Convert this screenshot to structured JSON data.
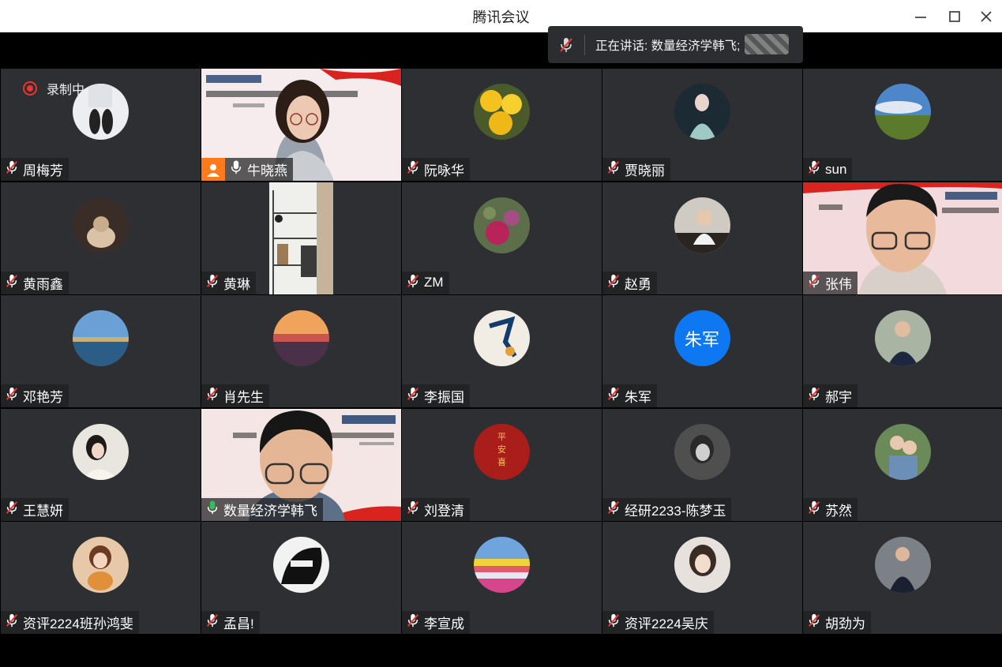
{
  "window": {
    "title": "腾讯会议"
  },
  "speaking": {
    "label": "正在讲话: 数量经济学韩飞;"
  },
  "recording": {
    "label": "录制中"
  },
  "colors": {
    "muted_red": "#ffffff",
    "speaking_green": "#2ec35a",
    "host_orange": "#ff7a1a",
    "tile_bg": "#2e2f33",
    "text_avatar_blue": "#0d78f2"
  },
  "participants": [
    {
      "name": "周梅芳",
      "mic": "muted",
      "avatar": "photo-feet"
    },
    {
      "name": "牛晓燕",
      "mic": "on",
      "avatar": "video",
      "host": true
    },
    {
      "name": "阮咏华",
      "mic": "muted",
      "avatar": "photo-flowers-yellow"
    },
    {
      "name": "贾晓丽",
      "mic": "muted",
      "avatar": "photo-woman-costume"
    },
    {
      "name": "sun",
      "mic": "muted",
      "avatar": "photo-landscape-sky"
    },
    {
      "name": "黄雨鑫",
      "mic": "muted",
      "avatar": "photo-cat"
    },
    {
      "name": "黄琳",
      "mic": "muted",
      "avatar": "photo-bookshelf"
    },
    {
      "name": "ZM",
      "mic": "muted",
      "avatar": "photo-flowers-pink"
    },
    {
      "name": "赵勇",
      "mic": "muted",
      "avatar": "photo-man-piano"
    },
    {
      "name": "张伟",
      "mic": "muted",
      "avatar": "video"
    },
    {
      "name": "邓艳芳",
      "mic": "muted",
      "avatar": "photo-lake"
    },
    {
      "name": "肖先生",
      "mic": "muted",
      "avatar": "photo-sunset"
    },
    {
      "name": "李振国",
      "mic": "muted",
      "avatar": "photo-gymnast"
    },
    {
      "name": "朱军",
      "mic": "muted",
      "avatar": "text",
      "avatar_text": "朱军"
    },
    {
      "name": "郝宇",
      "mic": "muted",
      "avatar": "photo-man-suit"
    },
    {
      "name": "王慧妍",
      "mic": "muted",
      "avatar": "photo-woman-white"
    },
    {
      "name": "数量经济学韩飞",
      "mic": "speaking",
      "avatar": "video"
    },
    {
      "name": "刘登清",
      "mic": "muted",
      "avatar": "photo-red-calligraphy"
    },
    {
      "name": "经研2233-陈梦玉",
      "mic": "muted",
      "avatar": "photo-woman-bw"
    },
    {
      "name": "苏然",
      "mic": "muted",
      "avatar": "photo-family"
    },
    {
      "name": "资评2224班孙鸿斐",
      "mic": "muted",
      "avatar": "photo-girl-cat"
    },
    {
      "name": "孟昌!",
      "mic": "muted",
      "avatar": "photo-man-sunglasses"
    },
    {
      "name": "李宣成",
      "mic": "muted",
      "avatar": "photo-tulip-field"
    },
    {
      "name": "资评2224吴庆",
      "mic": "muted",
      "avatar": "photo-woman-hair"
    },
    {
      "name": "胡劲为",
      "mic": "muted",
      "avatar": "photo-man-suit-dark"
    }
  ]
}
